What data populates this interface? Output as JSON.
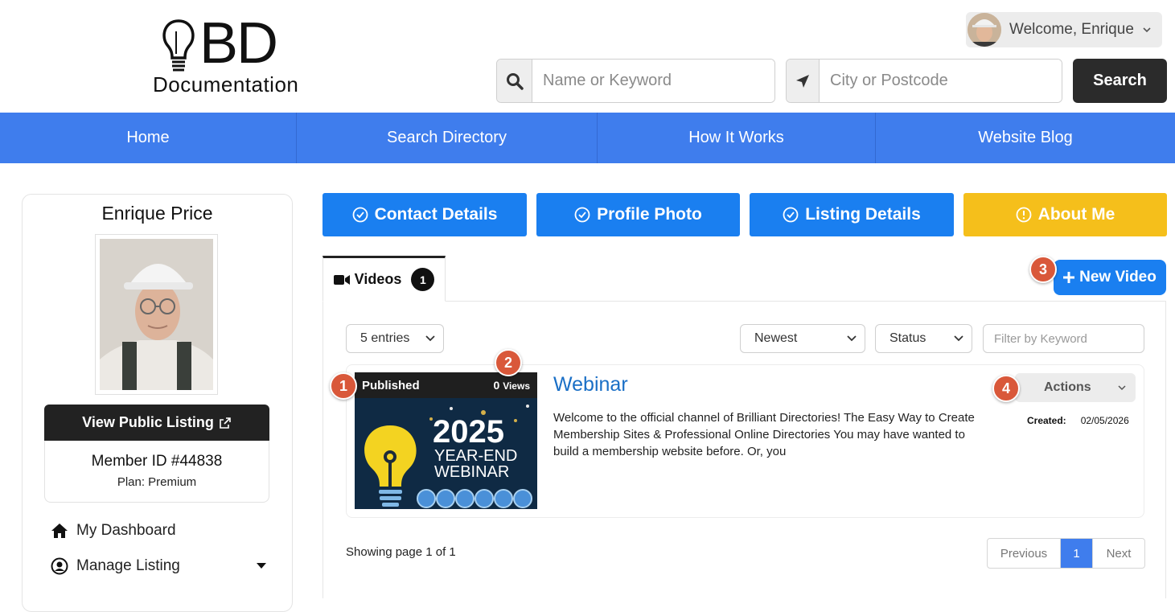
{
  "brand": {
    "logo_letters": "BD",
    "logo_sub": "Documentation"
  },
  "header": {
    "welcome": "Welcome, Enrique",
    "keyword_placeholder": "Name or Keyword",
    "city_placeholder": "City or Postcode",
    "search_label": "Search"
  },
  "nav": {
    "items": [
      "Home",
      "Search Directory",
      "How It Works",
      "Website Blog"
    ]
  },
  "profile": {
    "name": "Enrique Price",
    "view_listing": "View Public Listing",
    "member_id": "Member ID #44838",
    "plan": "Plan: Premium"
  },
  "sidebar": {
    "items": [
      "My Dashboard",
      "Manage Listing"
    ]
  },
  "steps": [
    {
      "label": "Contact Details",
      "status": "complete",
      "color": "#1a7ff0"
    },
    {
      "label": "Profile Photo",
      "status": "complete",
      "color": "#1a7ff0"
    },
    {
      "label": "Listing Details",
      "status": "complete",
      "color": "#1a7ff0"
    },
    {
      "label": "About Me",
      "status": "warning",
      "color": "#f5bf1b"
    }
  ],
  "tabs": {
    "videos_label": "Videos",
    "videos_count": "1"
  },
  "new_video": "New Video",
  "badges": [
    "1",
    "2",
    "3",
    "4"
  ],
  "filters": {
    "entries": "5 entries",
    "sort": "Newest",
    "status": "Status",
    "keyword_placeholder": "Filter by Keyword"
  },
  "video": {
    "status": "Published",
    "views_count": "0",
    "views_label": "Views",
    "thumb_year": "2025",
    "thumb_line1": "YEAR-END",
    "thumb_line2": "WEBINAR",
    "title": "Webinar",
    "description": "Welcome to the official channel of Brilliant Directories! The Easy Way to Create Membership Sites & Professional Online Directories You may have wanted to build a membership website before. Or, you",
    "actions_label": "Actions",
    "created_label": "Created:",
    "created_date": "02/05/2026"
  },
  "pagination": {
    "showing": "Showing page 1 of 1",
    "previous": "Previous",
    "current": "1",
    "next": "Next"
  }
}
